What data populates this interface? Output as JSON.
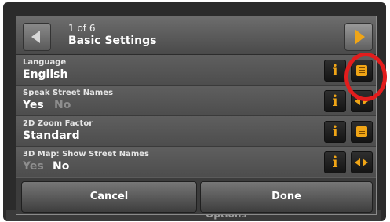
{
  "header": {
    "page_indicator": "1 of 6",
    "title": "Basic Settings"
  },
  "rows": [
    {
      "label": "Language",
      "value": "English",
      "action_icon": "list-icon"
    },
    {
      "label": "Speak Street Names",
      "value": "Yes",
      "value_inactive": "No",
      "action_icon": "left-right-arrows-icon"
    },
    {
      "label": "2D Zoom Factor",
      "value": "Standard",
      "action_icon": "list-icon"
    },
    {
      "label": "3D Map: Show Street Names",
      "value_inactive": "Yes",
      "value": "No",
      "action_icon": "left-right-arrows-icon"
    }
  ],
  "footer": {
    "cancel_label": "Cancel",
    "done_label": "Done"
  },
  "background_partial_text": "Options",
  "colors": {
    "accent": "#f0a516",
    "highlight": "#e21d1d",
    "panel": "#5b5b5b"
  }
}
